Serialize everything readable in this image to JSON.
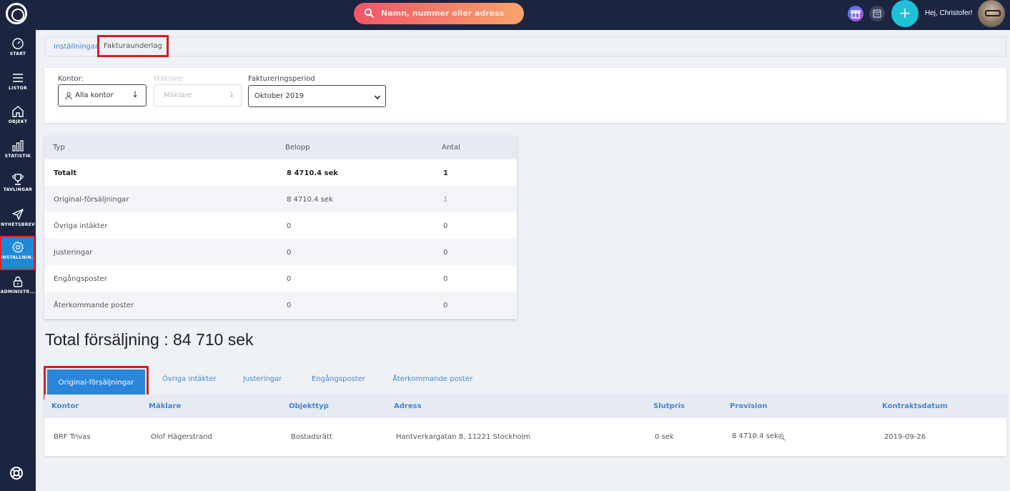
{
  "topbar": {
    "search_placeholder": "Namn, nummer eller adress",
    "greeting": "Hej, Christofer!"
  },
  "sidebar": {
    "items": [
      {
        "label": "START",
        "icon": "gauge-icon"
      },
      {
        "label": "LISTOR",
        "icon": "list-icon"
      },
      {
        "label": "OBJEKT",
        "icon": "home-icon"
      },
      {
        "label": "STATISTIK",
        "icon": "bar-chart-icon"
      },
      {
        "label": "TÄVLINGAR",
        "icon": "trophy-icon"
      },
      {
        "label": "NYHETSBREV",
        "icon": "paper-plane-icon"
      },
      {
        "label": "INSTÄLLNIN...",
        "icon": "gear-icon"
      },
      {
        "label": "ADMINISTR...",
        "icon": "lock-icon"
      }
    ],
    "active_index": 6
  },
  "breadcrumb": {
    "items": [
      "Inställningar",
      "Fakturaunderlag"
    ]
  },
  "filters": {
    "office": {
      "label": "Kontor:",
      "value": "Alla kontor"
    },
    "agent": {
      "label": "Mäklare:",
      "placeholder": "Mäklare"
    },
    "period": {
      "label": "Faktureringsperiod",
      "value": "Oktober 2019"
    }
  },
  "summary": {
    "columns": [
      "Typ",
      "Belopp",
      "Antal"
    ],
    "rows": [
      {
        "type": "Totalt",
        "amount": "8 4710.4 sek",
        "count": "1"
      },
      {
        "type": "Original-försäljningar",
        "amount": "8 4710.4 sek",
        "count": "1"
      },
      {
        "type": "Övriga intäkter",
        "amount": "0",
        "count": "0"
      },
      {
        "type": "Justeringar",
        "amount": "0",
        "count": "0"
      },
      {
        "type": "Engångsposter",
        "amount": "0",
        "count": "0"
      },
      {
        "type": "Återkommande poster",
        "amount": "0",
        "count": "0"
      }
    ]
  },
  "total_sales": "Total försäljning : 84 710 sek",
  "tabs": [
    "Original-försäljningar",
    "Övriga intäkter",
    "Justeringar",
    "Engångsposter",
    "Återkommande poster"
  ],
  "results": {
    "columns": [
      "Kontor",
      "Mäklare",
      "Objekttyp",
      "Adress",
      "Slutpris",
      "Provision",
      "Kontraktsdatum"
    ],
    "rows": [
      {
        "office": "BRF Trivas",
        "agent": "Olof Hägerstrand",
        "type": "Bostadsrätt",
        "address": "Hantverkargatan 8, 11221 Stockholm",
        "price": "0 sek",
        "commission": "8 4710.4 sek",
        "date": "2019-09-26"
      }
    ]
  },
  "colors": {
    "accent": "#2b85d9",
    "nav_bg": "#1c2540",
    "highlight": "#d21f26"
  }
}
